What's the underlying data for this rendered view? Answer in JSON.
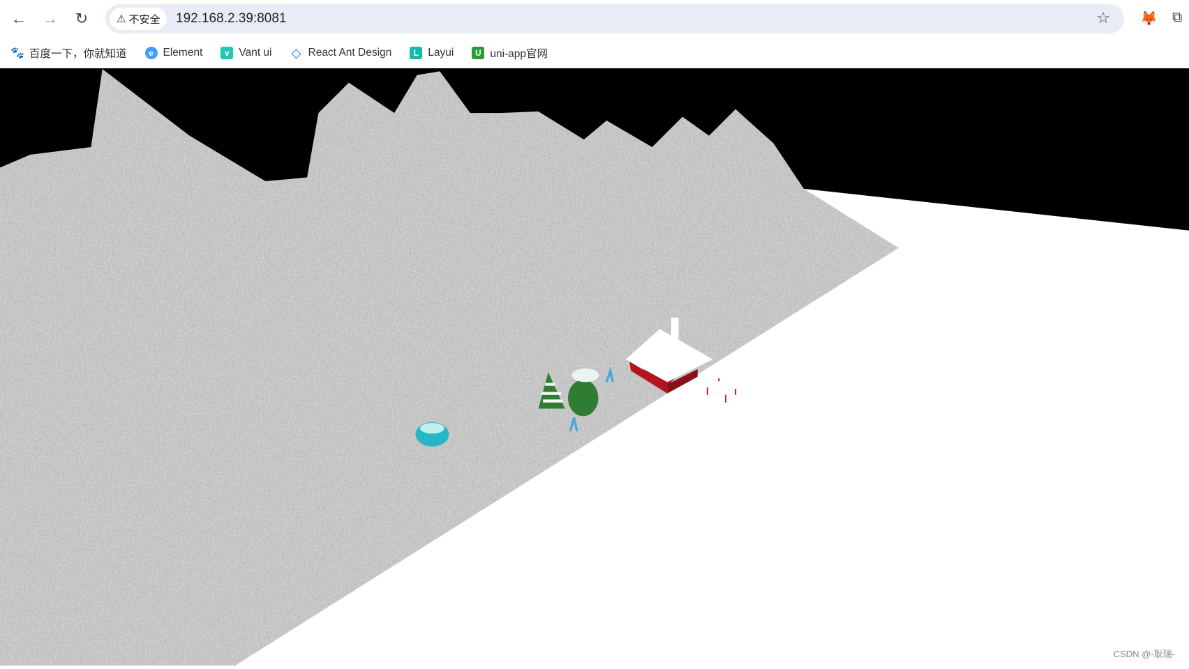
{
  "browser": {
    "security_label": "不安全",
    "url": "192.168.2.39:8081",
    "bookmarks": [
      {
        "label": "百度一下，你就知道",
        "icon": "baidu-paw-icon",
        "color": "#2932e1"
      },
      {
        "label": "Element",
        "icon": "element-icon",
        "color": "#409eff"
      },
      {
        "label": "Vant ui",
        "icon": "vant-icon",
        "color": "#1fc8b0"
      },
      {
        "label": "React Ant Design",
        "icon": "ant-design-icon",
        "color": "#1677ff"
      },
      {
        "label": "Layui",
        "icon": "layui-icon",
        "color": "#16baaa"
      },
      {
        "label": "uni-app官网",
        "icon": "uni-app-icon",
        "color": "#2b9939"
      }
    ]
  },
  "scene": {
    "background": "#000000",
    "ground": "#ffffff",
    "terrain": "#c8c8c8",
    "house": "#b3141d",
    "tree": "#2e7d32"
  },
  "watermark": "CSDN @-耿瑞-"
}
